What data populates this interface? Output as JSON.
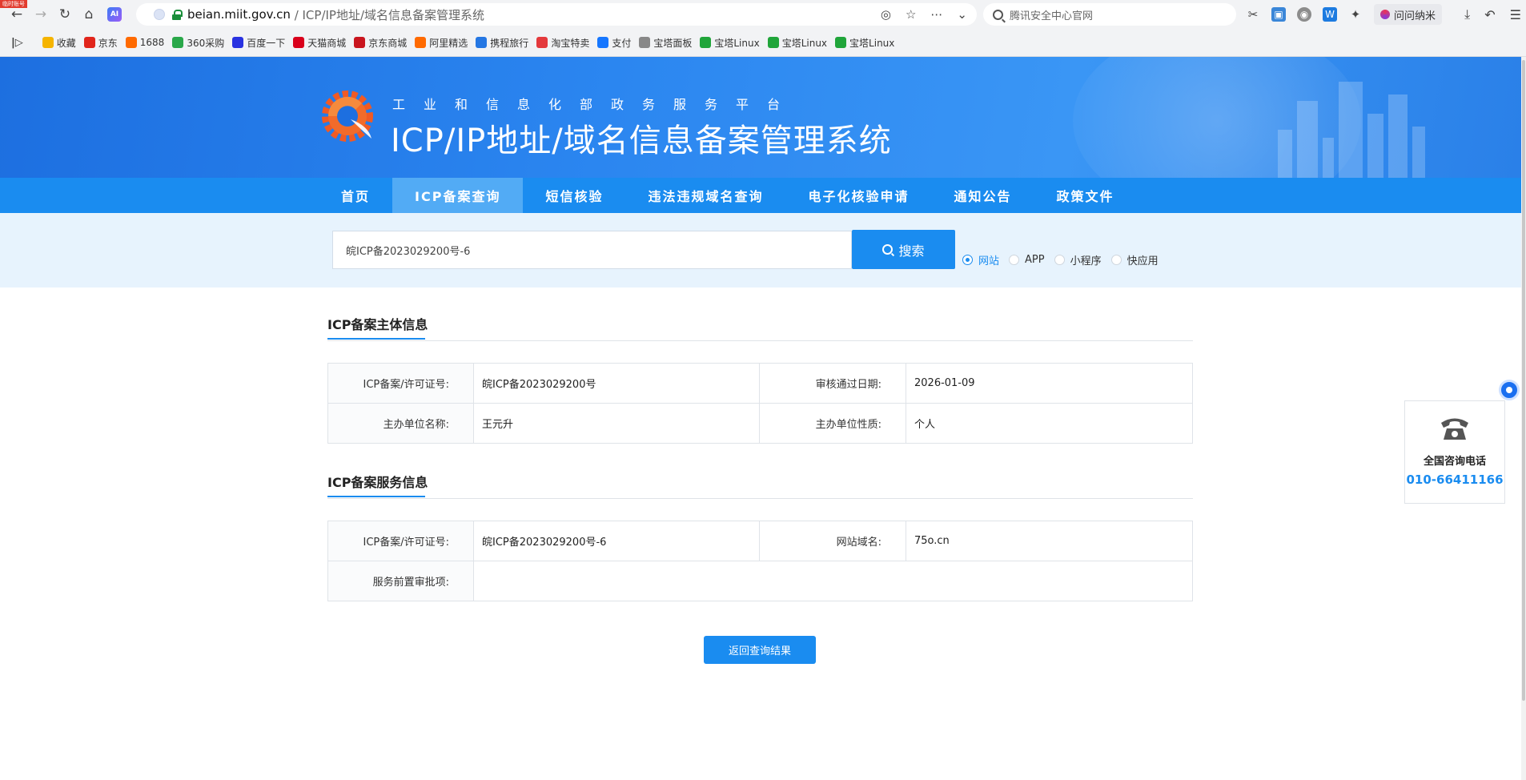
{
  "browser": {
    "corner_tag": "临时账号",
    "url_domain": "beian.miit.gov.cn",
    "url_path": " / ICP/IP地址/域名信息备案管理系统",
    "search_engine_placeholder": "腾讯安全中心官网",
    "ask_button": "问问纳米",
    "bookmarks": [
      {
        "label": "收藏",
        "icon": "star-icon",
        "color": "#f5b400"
      },
      {
        "label": "京东",
        "icon": "jd-icon",
        "color": "#e1251b"
      },
      {
        "label": "1688",
        "icon": "1688-icon",
        "color": "#ff6a00"
      },
      {
        "label": "360采购",
        "icon": "360-icon",
        "color": "#2aa84a"
      },
      {
        "label": "百度一下",
        "icon": "baidu-icon",
        "color": "#2932e1"
      },
      {
        "label": "天猫商城",
        "icon": "tmall-icon",
        "color": "#d9001b"
      },
      {
        "label": "京东商城",
        "icon": "jd-mall-icon",
        "color": "#c9151e"
      },
      {
        "label": "阿里精选",
        "icon": "ali-icon",
        "color": "#ff6a00"
      },
      {
        "label": "携程旅行",
        "icon": "ctrip-icon",
        "color": "#2577e3"
      },
      {
        "label": "淘宝特卖",
        "icon": "taobao-icon",
        "color": "#e4393c"
      },
      {
        "label": "支付",
        "icon": "pay-icon",
        "color": "#1677ff"
      },
      {
        "label": "宝塔面板",
        "icon": "bt-icon",
        "color": "#888888"
      },
      {
        "label": "宝塔Linux",
        "icon": "bt-shield-icon",
        "color": "#20a53a"
      },
      {
        "label": "宝塔Linux",
        "icon": "bt-shield-icon",
        "color": "#20a53a"
      },
      {
        "label": "宝塔Linux",
        "icon": "bt-shield-icon",
        "color": "#20a53a"
      }
    ]
  },
  "site": {
    "subtitle": "工业和信息化部政务服务平台",
    "title": "ICP/IP地址/域名信息备案管理系统",
    "nav": [
      {
        "label": "首页",
        "active": false
      },
      {
        "label": "ICP备案查询",
        "active": true
      },
      {
        "label": "短信核验",
        "active": false
      },
      {
        "label": "违法违规域名查询",
        "active": false
      },
      {
        "label": "电子化核验申请",
        "active": false
      },
      {
        "label": "通知公告",
        "active": false
      },
      {
        "label": "政策文件",
        "active": false
      }
    ]
  },
  "search": {
    "value": "皖ICP备2023029200号-6",
    "button": "搜索",
    "types": [
      {
        "label": "网站",
        "checked": true
      },
      {
        "label": "APP",
        "checked": false
      },
      {
        "label": "小程序",
        "checked": false
      },
      {
        "label": "快应用",
        "checked": false
      }
    ]
  },
  "subject_info": {
    "title": "ICP备案主体信息",
    "rows": [
      {
        "label1": "ICP备案/许可证号:",
        "value1": "皖ICP备2023029200号",
        "label2": "审核通过日期:",
        "value2": "2026-01-09"
      },
      {
        "label1": "主办单位名称:",
        "value1": "王元升",
        "label2": "主办单位性质:",
        "value2": "个人"
      }
    ]
  },
  "service_info": {
    "title": "ICP备案服务信息",
    "license_label": "ICP备案/许可证号:",
    "license_value": "皖ICP备2023029200号-6",
    "domain_label": "网站域名:",
    "domain_value": "75o.cn",
    "approval_label": "服务前置审批项:",
    "approval_value": ""
  },
  "back_button": "返回查询结果",
  "consult": {
    "title": "全国咨询电话",
    "phone": "010-66411166"
  },
  "colors": {
    "brand_blue": "#1a8cf0",
    "active_tab": "#52abf5"
  }
}
